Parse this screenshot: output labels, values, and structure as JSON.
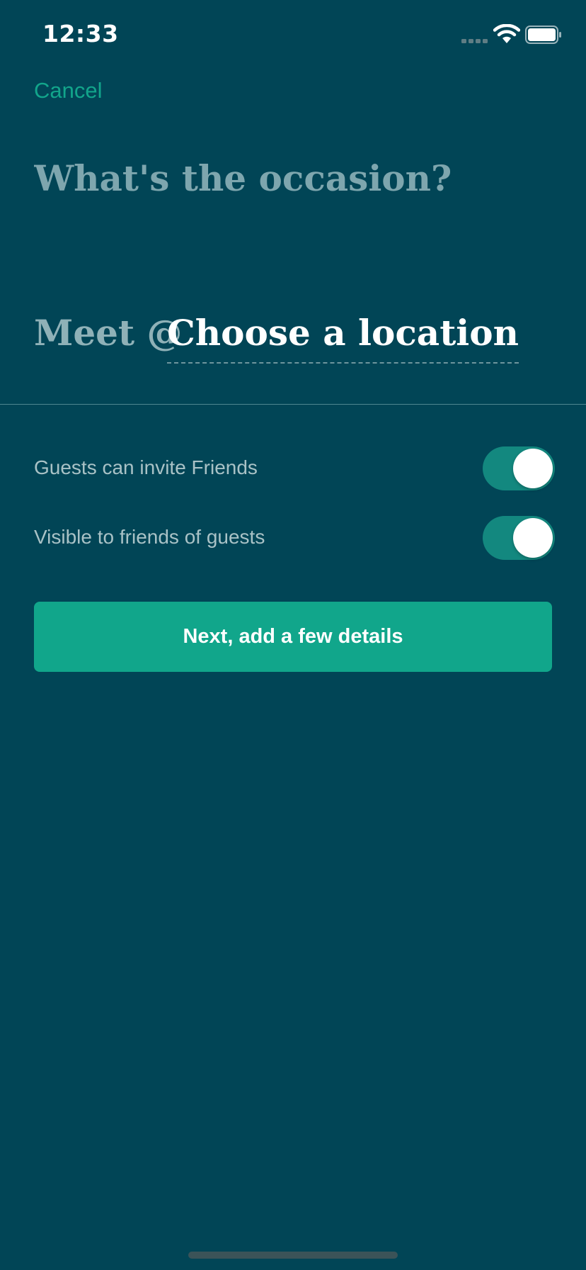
{
  "status_bar": {
    "time": "12:33",
    "icons": [
      "cellular-signal-icon",
      "wifi-icon",
      "battery-icon"
    ]
  },
  "nav": {
    "cancel_label": "Cancel"
  },
  "form": {
    "occasion_placeholder": "What's the occasion?",
    "occasion_value": "",
    "meet_label": "Meet @",
    "location_placeholder": "Choose a location"
  },
  "settings": [
    {
      "label": "Guests can invite Friends",
      "enabled": true
    },
    {
      "label": "Visible to friends of guests",
      "enabled": true
    }
  ],
  "actions": {
    "next_label": "Next, add a few details"
  },
  "colors": {
    "background": "#014556",
    "accent": "#11a68b",
    "toggle_on": "#13887f",
    "muted_text": "#a9c2c6",
    "placeholder_text": "#7ea6ae"
  }
}
